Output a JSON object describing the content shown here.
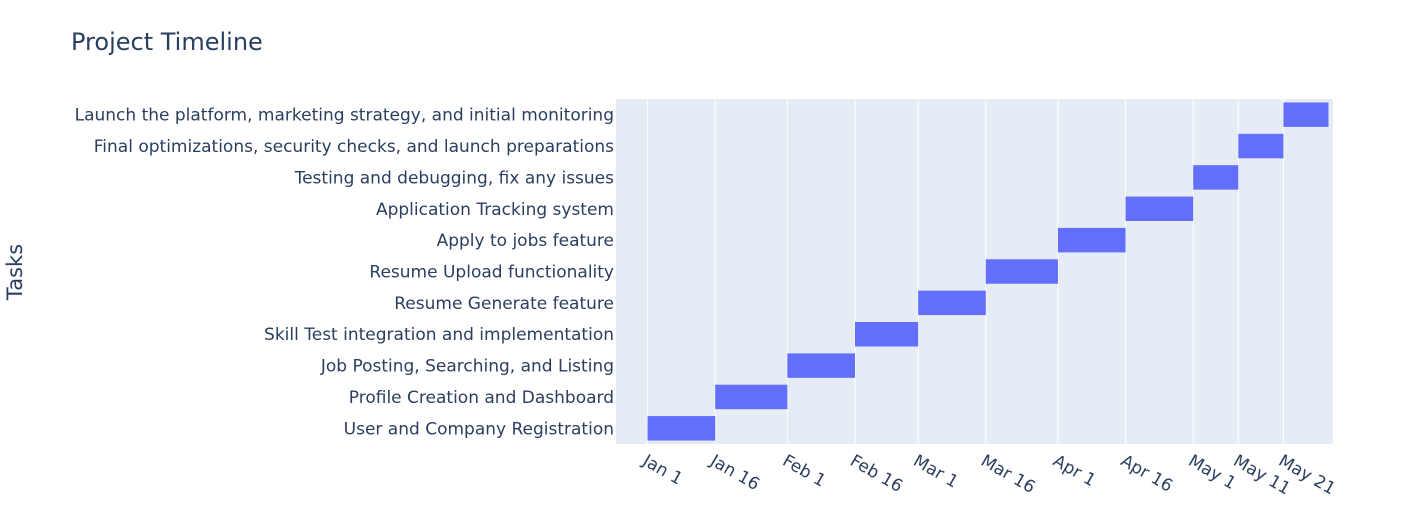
{
  "chart_data": {
    "type": "bar",
    "orientation": "horizontal",
    "title": "Project Timeline",
    "xlabel": "",
    "ylabel": "Tasks",
    "x_axis_type": "date",
    "x_range": [
      "2023-12-25",
      "2024-06-01"
    ],
    "x_ticks": [
      {
        "date": "2024-01-01",
        "label": "Jan 1"
      },
      {
        "date": "2024-01-16",
        "label": "Jan 16"
      },
      {
        "date": "2024-02-01",
        "label": "Feb 1"
      },
      {
        "date": "2024-02-16",
        "label": "Feb 16"
      },
      {
        "date": "2024-03-01",
        "label": "Mar 1"
      },
      {
        "date": "2024-03-16",
        "label": "Mar 16"
      },
      {
        "date": "2024-04-01",
        "label": "Apr 1"
      },
      {
        "date": "2024-04-16",
        "label": "Apr 16"
      },
      {
        "date": "2024-05-01",
        "label": "May 1"
      },
      {
        "date": "2024-05-11",
        "label": "May 11"
      },
      {
        "date": "2024-05-21",
        "label": "May 21"
      }
    ],
    "tasks": [
      {
        "task": "User and Company Registration",
        "start": "2024-01-01",
        "end": "2024-01-16"
      },
      {
        "task": "Profile Creation and Dashboard",
        "start": "2024-01-16",
        "end": "2024-02-01"
      },
      {
        "task": "Job Posting, Searching, and Listing",
        "start": "2024-02-01",
        "end": "2024-02-16"
      },
      {
        "task": "Skill Test integration and implementation",
        "start": "2024-02-16",
        "end": "2024-03-01"
      },
      {
        "task": "Resume Generate feature",
        "start": "2024-03-01",
        "end": "2024-03-16"
      },
      {
        "task": "Resume Upload functionality",
        "start": "2024-03-16",
        "end": "2024-04-01"
      },
      {
        "task": "Apply to jobs feature",
        "start": "2024-04-01",
        "end": "2024-04-16"
      },
      {
        "task": "Application Tracking system",
        "start": "2024-04-16",
        "end": "2024-05-01"
      },
      {
        "task": "Testing and debugging, fix any issues",
        "start": "2024-05-01",
        "end": "2024-05-11"
      },
      {
        "task": "Final optimizations, security checks, and launch preparations",
        "start": "2024-05-11",
        "end": "2024-05-21"
      },
      {
        "task": "Launch the platform, marketing strategy, and initial monitoring",
        "start": "2024-05-21",
        "end": "2024-05-31"
      }
    ],
    "grid": true,
    "colors": {
      "bar": "#636efa",
      "plot_background": "#e5ecf6",
      "grid": "#ffffff",
      "text": "#2a3f5f"
    }
  }
}
